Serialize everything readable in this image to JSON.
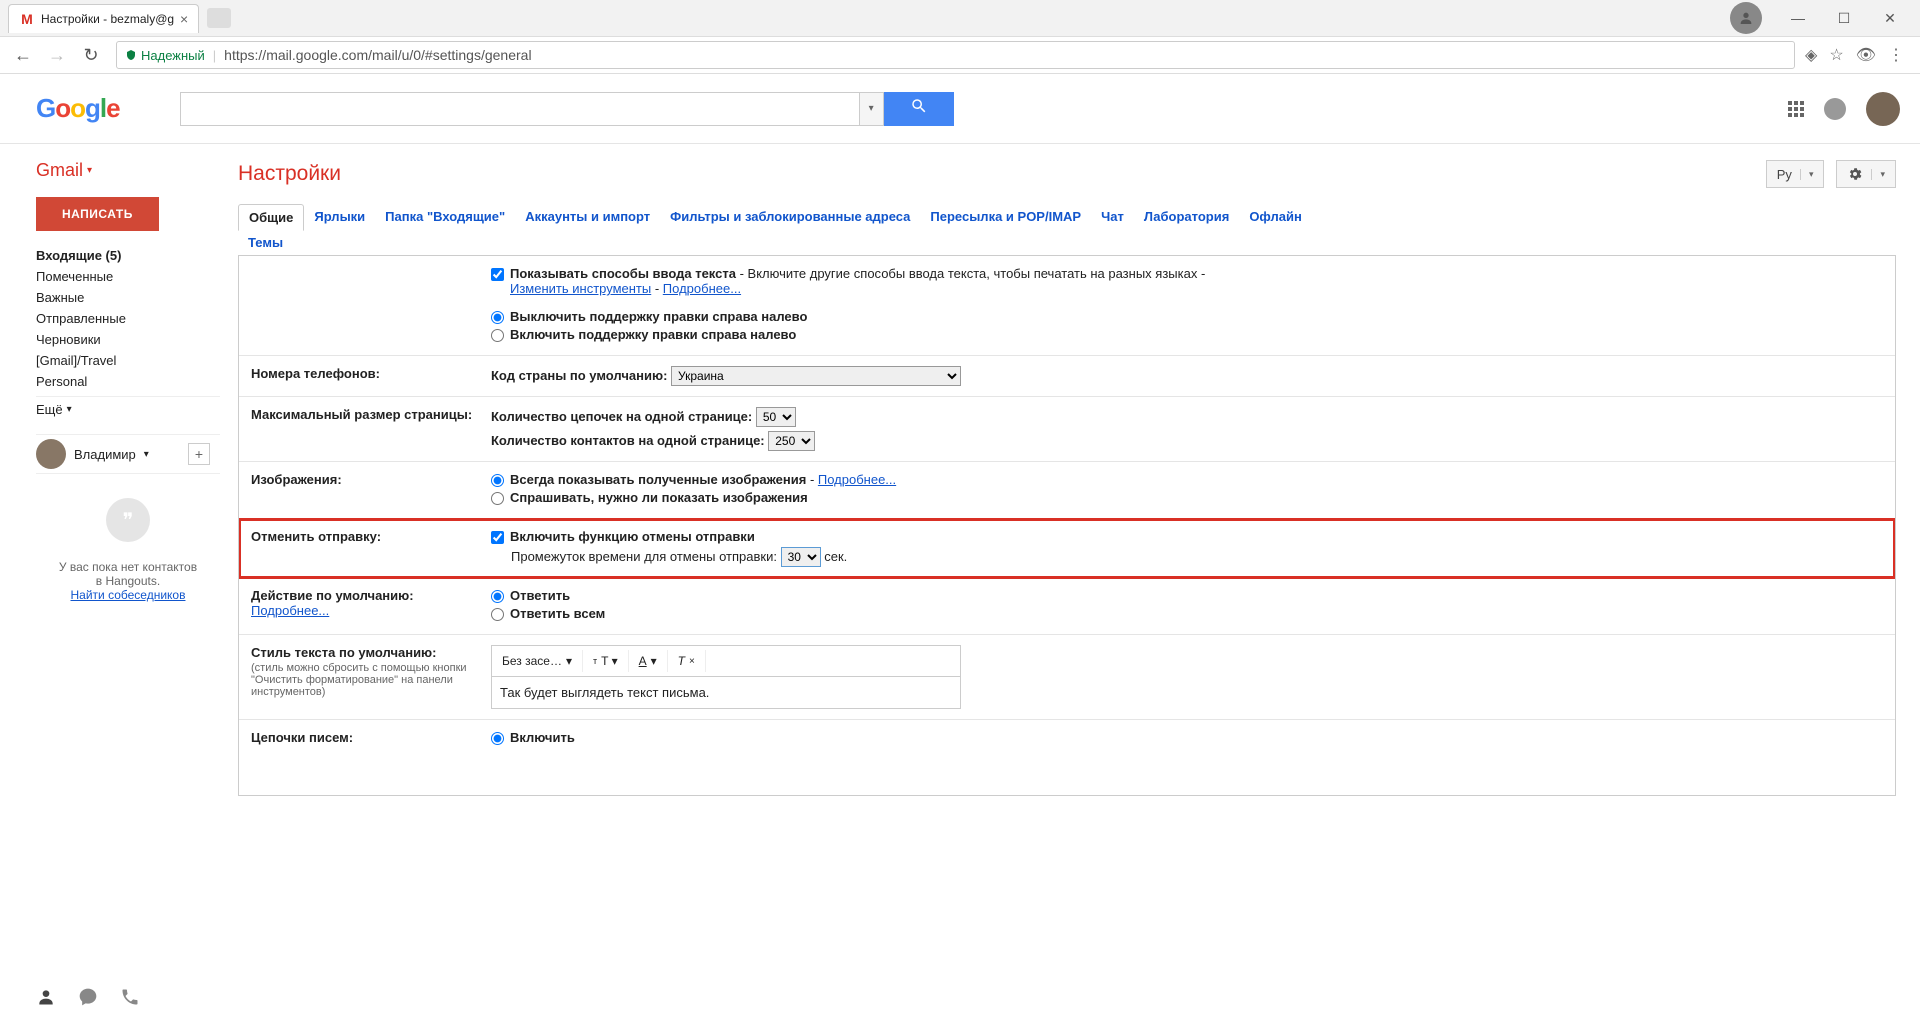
{
  "browser": {
    "tab_title": "Настройки - bezmaly@g",
    "secure_label": "Надежный",
    "url": "https://mail.google.com/mail/u/0/#settings/general"
  },
  "header": {
    "search_placeholder": ""
  },
  "sidebar": {
    "gmail_label": "Gmail",
    "compose": "НАПИСАТЬ",
    "items": [
      {
        "label": "Входящие (5)",
        "bold": true
      },
      {
        "label": "Помеченные"
      },
      {
        "label": "Важные"
      },
      {
        "label": "Отправленные"
      },
      {
        "label": "Черновики"
      },
      {
        "label": "[Gmail]/Travel"
      },
      {
        "label": "Personal"
      }
    ],
    "more": "Ещё",
    "hangouts_user": "Владимир",
    "hangouts_empty_1": "У вас пока нет контактов",
    "hangouts_empty_2": "в Hangouts.",
    "hangouts_find": "Найти собеседников"
  },
  "main": {
    "title": "Настройки",
    "lang_short": "Ру"
  },
  "tabs": [
    "Общие",
    "Ярлыки",
    "Папка \"Входящие\"",
    "Аккаунты и импорт",
    "Фильтры и заблокированные адреса",
    "Пересылка и POP/IMAP",
    "Чат",
    "Лаборатория",
    "Офлайн",
    "Темы"
  ],
  "settings": {
    "input_methods": {
      "checkbox_label": "Показывать способы ввода текста",
      "desc": " - Включите другие способы ввода текста, чтобы печатать на разных языках - ",
      "link1": "Изменить инструменты",
      "link2": "Подробнее...",
      "rtl_off": "Выключить поддержку правки справа налево",
      "rtl_on": "Включить поддержку правки справа налево"
    },
    "phone": {
      "label": "Номера телефонов:",
      "country_label": "Код страны по умолчанию:",
      "country_value": "Украина"
    },
    "pagesize": {
      "label": "Максимальный размер страницы:",
      "threads_label": "Количество цепочек на одной странице:",
      "threads_value": "50",
      "contacts_label": "Количество контактов на одной странице:",
      "contacts_value": "250"
    },
    "images": {
      "label": "Изображения:",
      "always": "Всегда показывать полученные изображения",
      "more": "Подробнее...",
      "ask": "Спрашивать, нужно ли показать изображения"
    },
    "undo": {
      "label": "Отменить отправку:",
      "enable": "Включить функцию отмены отправки",
      "period_label": "Промежуток времени для отмены отправки:",
      "period_value": "30",
      "sec": "сек."
    },
    "default_action": {
      "label": "Действие по умолчанию:",
      "more": "Подробнее...",
      "reply": "Ответить",
      "reply_all": "Ответить всем"
    },
    "text_style": {
      "label": "Стиль текста по умолчанию:",
      "sub": "(стиль можно сбросить с помощью кнопки \"Очистить форматирование\" на панели инструментов)",
      "font": "Без засе…",
      "sample": "Так будет выглядеть текст письма."
    },
    "threads": {
      "label": "Цепочки писем:",
      "on": "Включить"
    }
  }
}
